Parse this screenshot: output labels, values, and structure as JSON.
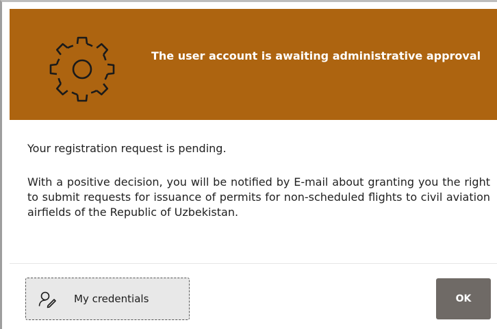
{
  "header": {
    "icon": "gear-icon",
    "title": "The user account is awaiting administrative approval",
    "background_color": "#ad6410"
  },
  "message": {
    "status": "Your registration request is pending.",
    "details": "With a positive decision, you will be notified by E-mail about granting you the right to submit requests for issuance of permits for non-scheduled flights to civil aviation airfields of the Republic of Uzbekistan."
  },
  "footer": {
    "credentials_button": {
      "icon": "user-edit-icon",
      "label": "My credentials"
    },
    "ok_button": {
      "label": "OK",
      "color": "#6f6a66"
    }
  }
}
